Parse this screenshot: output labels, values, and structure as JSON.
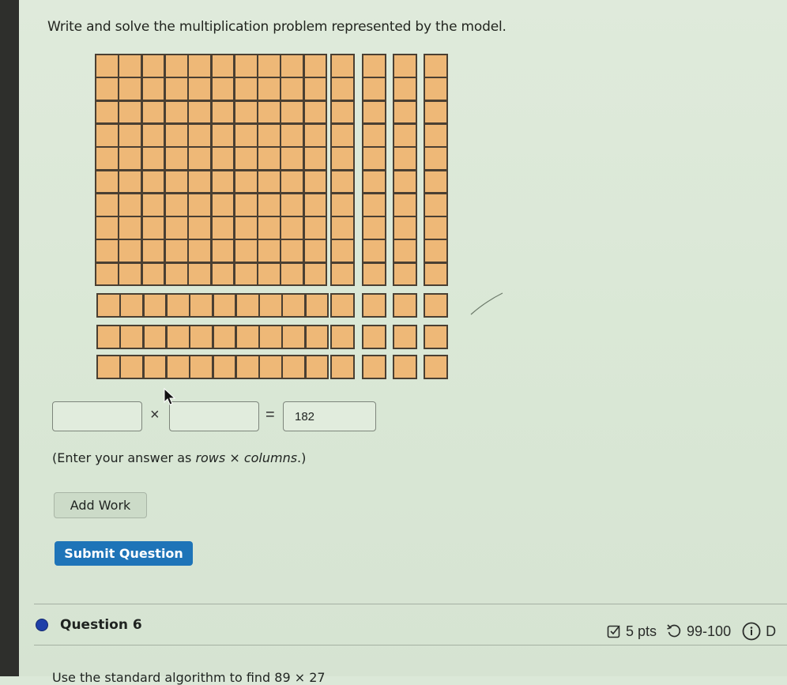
{
  "question": {
    "prompt": "Write and solve the multiplication problem represented by the model.",
    "model": {
      "description": "base-ten area model",
      "hundreds_block": {
        "rows": 10,
        "columns": 10
      },
      "vertical_ten_rods": 4,
      "horizontal_ten_rods": 3,
      "unit_cubes": 12,
      "total_rows": 13,
      "total_columns": 14,
      "fill_color": "#eeb877",
      "border_color": "#4a3f32"
    },
    "equation": {
      "factor1": {
        "value": "",
        "placeholder": ""
      },
      "times_symbol": "×",
      "factor2": {
        "value": "",
        "placeholder": ""
      },
      "equals_symbol": "=",
      "product": {
        "value": "182"
      }
    },
    "hint_prefix": "(Enter your answer as ",
    "hint_rows": "rows",
    "hint_times": " × ",
    "hint_columns": "columns",
    "hint_suffix": ".)",
    "add_work_label": "Add Work",
    "submit_label": "Submit Question"
  },
  "next_question": {
    "title": "Question 6",
    "points": "5 pts",
    "attempts": "99-100",
    "extra_cut": "D",
    "cut_off_text": "Use the standard algorithm to find 89 × 27",
    "status_color": "#1e3fa8",
    "icons": {
      "points": "checkbox-icon",
      "attempts": "redo-icon",
      "info": "info-icon"
    }
  },
  "colors": {
    "accent": "#1e74b8",
    "background": "#dbe8d8"
  }
}
